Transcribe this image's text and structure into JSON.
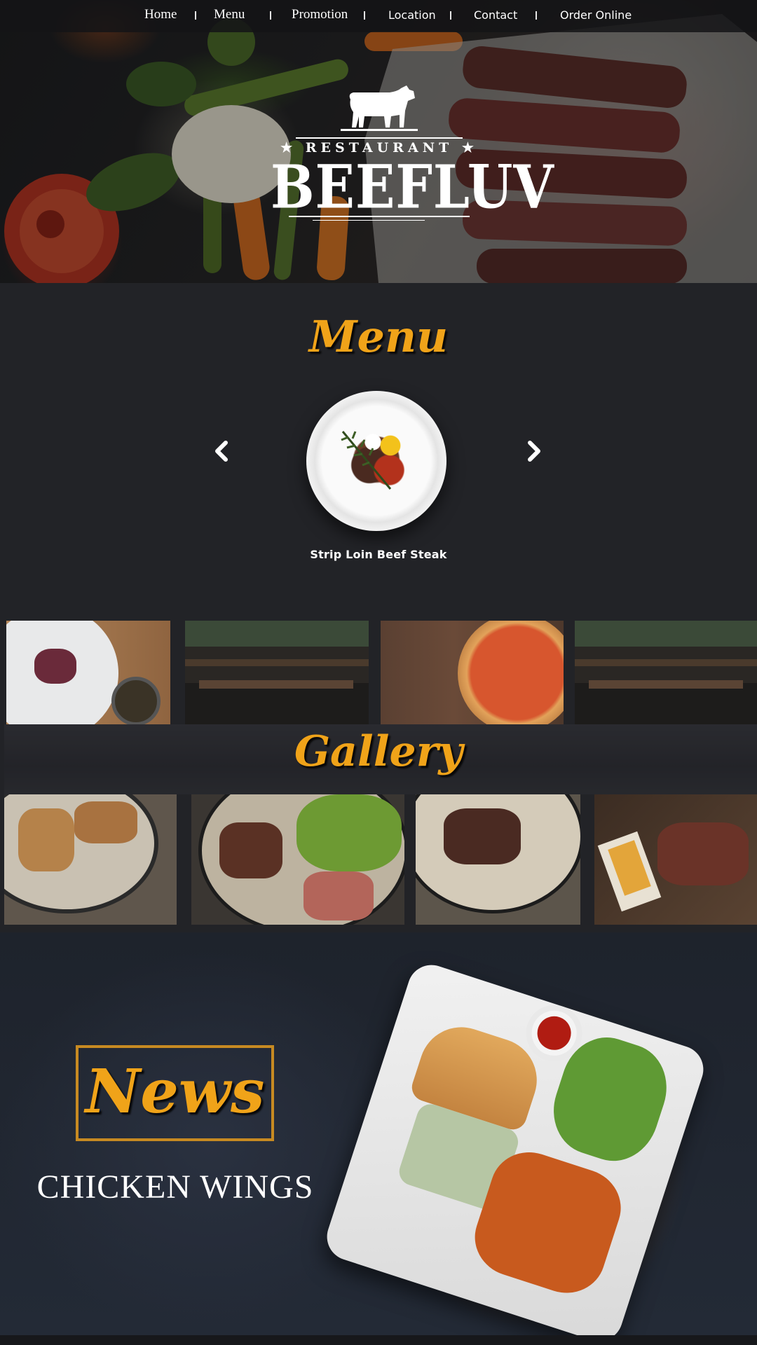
{
  "nav": {
    "items": [
      "Home",
      "Menu",
      "Promotion",
      "Location",
      "Contact",
      "Order Online"
    ]
  },
  "logo": {
    "small_text": "RESTAURANT",
    "brand": "BEEFLUV",
    "icon": "cow-icon"
  },
  "menu": {
    "title": "Menu",
    "current_dish": "Strip Loin Beef Steak",
    "prev_icon": "chevron-left-icon",
    "next_icon": "chevron-right-icon"
  },
  "gallery": {
    "title": "Gallery"
  },
  "news": {
    "title": "News",
    "headline": "CHICKEN WINGS"
  },
  "colors": {
    "accent": "#f0a319",
    "background": "#222327"
  }
}
